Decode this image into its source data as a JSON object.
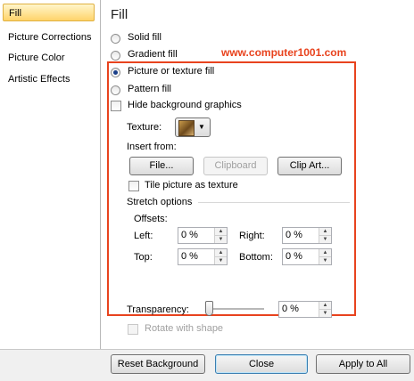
{
  "sidebar": {
    "items": [
      {
        "label": "Fill",
        "selected": true
      },
      {
        "label": "Picture Corrections",
        "selected": false
      },
      {
        "label": "Picture Color",
        "selected": false
      },
      {
        "label": "Artistic Effects",
        "selected": false
      }
    ]
  },
  "fill": {
    "title": "Fill",
    "watermark": "www.computer1001.com",
    "options": [
      {
        "label": "Solid fill",
        "checked": false
      },
      {
        "label": "Gradient fill",
        "checked": false
      },
      {
        "label": "Picture or texture fill",
        "checked": true
      },
      {
        "label": "Pattern fill",
        "checked": false
      }
    ],
    "hide_bg_label": "Hide background graphics",
    "texture_label": "Texture:",
    "insert_from_label": "Insert from:",
    "file_button": "File...",
    "clipboard_button": "Clipboard",
    "clipart_button": "Clip Art...",
    "tile_label": "Tile picture as texture",
    "stretch_options_label": "Stretch options",
    "offsets_label": "Offsets:",
    "left_label": "Left:",
    "left_value": "0 %",
    "right_label": "Right:",
    "right_value": "0 %",
    "top_label": "Top:",
    "top_value": "0 %",
    "bottom_label": "Bottom:",
    "bottom_value": "0 %",
    "transparency_label": "Transparency:",
    "transparency_value": "0 %",
    "rotate_label": "Rotate with shape"
  },
  "footer": {
    "reset_button": "Reset Background",
    "close_button": "Close",
    "apply_all_button": "Apply to All"
  }
}
